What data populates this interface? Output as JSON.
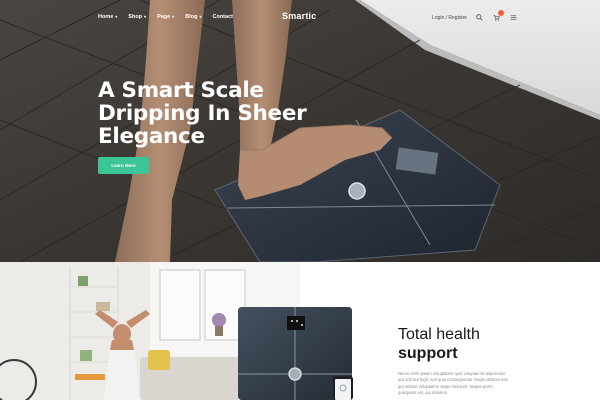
{
  "header": {
    "logo": "Smartic",
    "nav": [
      {
        "label": "Home",
        "caret": "▾"
      },
      {
        "label": "Shop",
        "caret": "▾"
      },
      {
        "label": "Page",
        "caret": "▾"
      },
      {
        "label": "Blog",
        "caret": "▾"
      },
      {
        "label": "Contact",
        "caret": ""
      }
    ],
    "login_label": "Login / Register",
    "icons": [
      "search-icon",
      "cart-icon",
      "menu-icon"
    ]
  },
  "hero": {
    "title_lines": [
      "A Smart Scale",
      "Dripping In Sheer",
      "Elegance"
    ],
    "cta_label": "Learn More"
  },
  "feature": {
    "title_line1": "Total health",
    "title_line2": "support",
    "body": "Nemo enim ipsam voluptatem quia voluptas sit aspernatur aut odit aut fugit, sed quia consequuntur magni dolores eos qui ratione voluptatem sequi nesciunt. Neque porro quisquam est, qui dolorem"
  },
  "colors": {
    "accent": "#3cc597",
    "badge": "#f25c3c",
    "hero_floor": "#3d3935",
    "scale": "#2d3440"
  }
}
